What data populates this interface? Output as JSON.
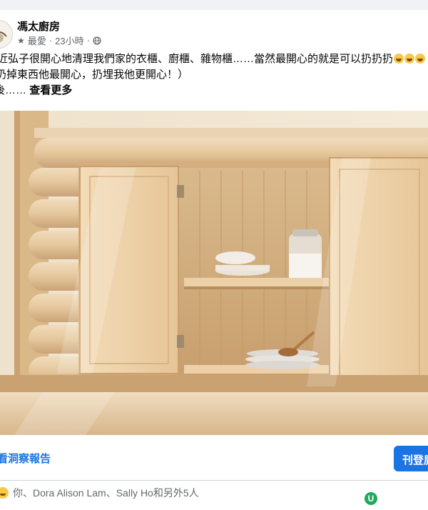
{
  "post": {
    "page_name": "馮太廚房",
    "meta_label": "最愛",
    "meta_time": "23小時",
    "text_line1": "近弘子很開心地清理我們家的衣櫃、廚櫃、雜物櫃……當然最開心的就是可以扔扔扔",
    "text_line2": "扔掉東西他最開心，扔埋我他更開心！）",
    "text_line3_prefix": "後……",
    "see_more": "查看更多"
  },
  "photo": {
    "subject": "light pine wood cabinet with open doors on log wall"
  },
  "actions": {
    "insights": "看洞察報告",
    "boost": "刊登廣"
  },
  "reactions": {
    "summary": "你、Dora Alison Lam、Sally Ho和另外5人"
  },
  "badge": {
    "letter": "U"
  },
  "icons": [
    "avatar-logo-icon",
    "star-icon",
    "globe-icon",
    "emoji-icon",
    "haha-reaction-icon",
    "u-badge-icon"
  ],
  "colors": {
    "link_blue": "#1b74e4",
    "secondary_text": "#65676b",
    "wood_light": "#e9cfa7",
    "wood_mid": "#d6b386"
  }
}
